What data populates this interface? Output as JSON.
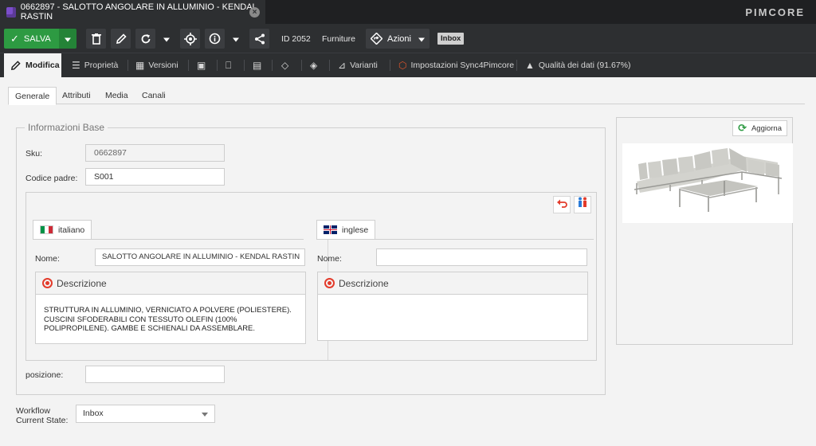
{
  "window": {
    "tab_title": "0662897 - SALOTTO ANGOLARE IN ALLUMINIO - KENDAL RASTIN",
    "brand": "PIMCORE"
  },
  "toolbar": {
    "save_label": "SALVA",
    "id_label": "ID 2052",
    "class_label": "Furniture",
    "actions_label": "Azioni",
    "state_badge": "Inbox"
  },
  "subtabs": [
    {
      "label": "Modifica",
      "icon": "pencil-icon"
    },
    {
      "label": "Proprietà",
      "icon": "sliders-icon"
    },
    {
      "label": "Versioni",
      "icon": "versions-icon"
    },
    {
      "label": "",
      "icon": "calendar-icon"
    },
    {
      "label": "",
      "icon": "bookmark-icon"
    },
    {
      "label": "",
      "icon": "clipboard-icon"
    },
    {
      "label": "",
      "icon": "tag-icon"
    },
    {
      "label": "",
      "icon": "workflow-icon"
    },
    {
      "label": "Varianti",
      "icon": "variants-icon"
    },
    {
      "label": "Impostazioni Sync4Pimcore",
      "icon": "sync-icon"
    },
    {
      "label": "Qualità dei dati (91.67%)",
      "icon": "quality-icon"
    }
  ],
  "innertabs": [
    "Generale",
    "Attributi",
    "Media",
    "Canali"
  ],
  "form": {
    "legend": "Informazioni Base",
    "sku_label": "Sku:",
    "sku_value": "0662897",
    "parent_label": "Codice padre:",
    "parent_value": "S001",
    "position_label": "posizione:",
    "position_value": "",
    "locales": {
      "it": {
        "tab": "italiano",
        "name_label": "Nome:",
        "name_value": "SALOTTO ANGOLARE IN ALLUMINIO - KENDAL RASTIN",
        "desc_title": "Descrizione",
        "desc_text": "STRUTTURA IN ALLUMINIO, VERNICIATO A POLVERE (POLIESTERE). CUSCINI SFODERABILI CON TESSUTO OLEFIN (100% POLIPROPILENE). GAMBE E SCHIENALI DA ASSEMBLARE."
      },
      "en": {
        "tab": "inglese",
        "name_label": "Nome:",
        "name_value": "",
        "desc_title": "Descrizione",
        "desc_text": ""
      }
    }
  },
  "workflow": {
    "label_line1": "Workflow",
    "label_line2": "Current State:",
    "value": "Inbox"
  },
  "image_panel": {
    "refresh_label": "Aggiorna"
  },
  "colors": {
    "save_green": "#2d9a42",
    "dark_bg": "#2d2f31",
    "accent_red": "#e33b2b"
  }
}
